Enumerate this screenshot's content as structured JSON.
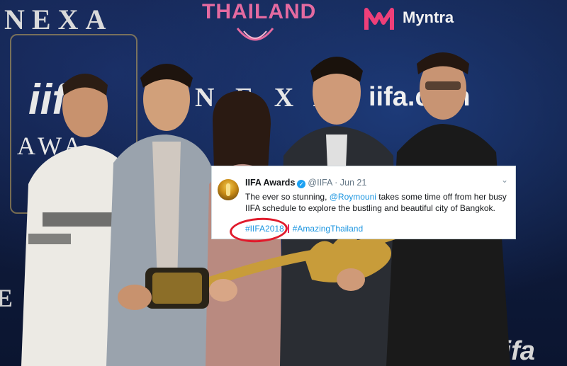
{
  "backdrop": {
    "nexa_text": "NEXA",
    "nexa_mid_text": "N E X A",
    "nexa_left_text": "E X A",
    "iifa_web_text": "iifa.com",
    "iifa_big_text": "iifa",
    "awards_text": "AWA",
    "iifa_corner_text": "iifa",
    "sponsors": {
      "thailand": "THAILAND",
      "myntra": "Myntra"
    }
  },
  "tweet": {
    "name": "IIFA Awards",
    "verified_icon": "verified-badge-icon",
    "handle": "@IIFA",
    "separator": "·",
    "date": "Jun 21",
    "text_before": "The ever so stunning, ",
    "mention": "@Roymouni",
    "text_after": " takes some time off from her busy IIFA schedule to explore the bustling and beautiful city of Bangkok.",
    "hashtags": [
      "#IIFA2018",
      "#AmazingThailand"
    ],
    "highlight_color": "#e01b2c",
    "link_color": "#1b95e0"
  }
}
